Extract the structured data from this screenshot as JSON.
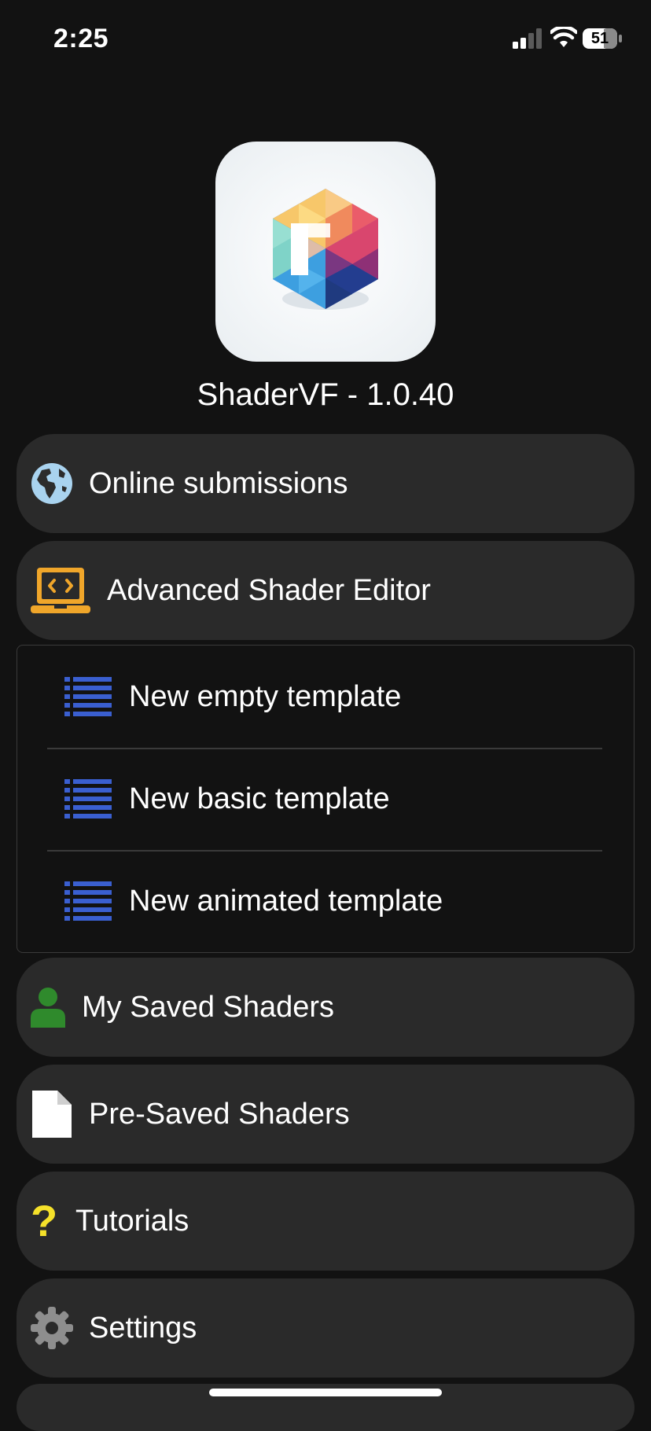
{
  "status_bar": {
    "time": "2:25",
    "battery": "51"
  },
  "app": {
    "title": "ShaderVF - 1.0.40"
  },
  "menu": {
    "online_submissions": "Online submissions",
    "advanced_editor": "Advanced Shader Editor",
    "my_saved": "My Saved Shaders",
    "pre_saved": "Pre-Saved Shaders",
    "tutorials": "Tutorials",
    "settings": "Settings"
  },
  "submenu": {
    "items": [
      {
        "label": "New empty template",
        "icon": "list-icon"
      },
      {
        "label": "New basic template",
        "icon": "list-icon"
      },
      {
        "label": "New animated template",
        "icon": "list-icon"
      }
    ]
  },
  "colors": {
    "background": "#121212",
    "row_background": "#2a2a2a",
    "list_icon": "#3a5fd0",
    "laptop_icon": "#f0a62a",
    "person_icon": "#2f8a2c",
    "question_icon": "#f5e12a",
    "gear_icon": "#8e8e8e"
  }
}
